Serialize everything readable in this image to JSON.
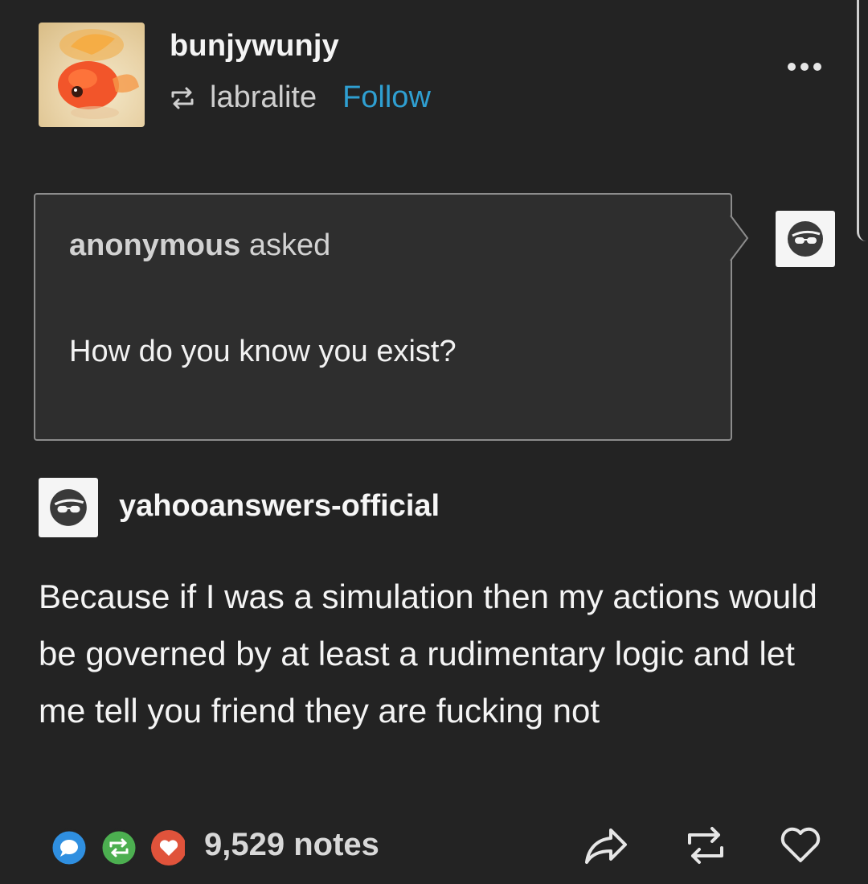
{
  "post": {
    "author": "bunjywunjy",
    "reblogged_from": "labralite",
    "follow_label": "Follow"
  },
  "ask": {
    "asker": "anonymous",
    "asked_label": "asked",
    "question": "How do you know you exist?"
  },
  "answer": {
    "answerer": "yahooanswers-official",
    "text": "Because if I was a simulation then my actions would be governed by at least a rudimentary logic and let me tell you friend they are fucking not"
  },
  "footer": {
    "notes": "9,529 notes"
  },
  "colors": {
    "background": "#232323",
    "link": "#2f9fd1",
    "reply_bubble": "#2f8fe0",
    "reblog_bubble": "#4caf50",
    "like_bubble": "#e0533b"
  },
  "icons": [
    "goldfish-avatar",
    "reblog-icon",
    "more-icon",
    "sunglasses-avatar",
    "notes-bubbles",
    "share-icon",
    "reblog-icon",
    "heart-icon"
  ]
}
